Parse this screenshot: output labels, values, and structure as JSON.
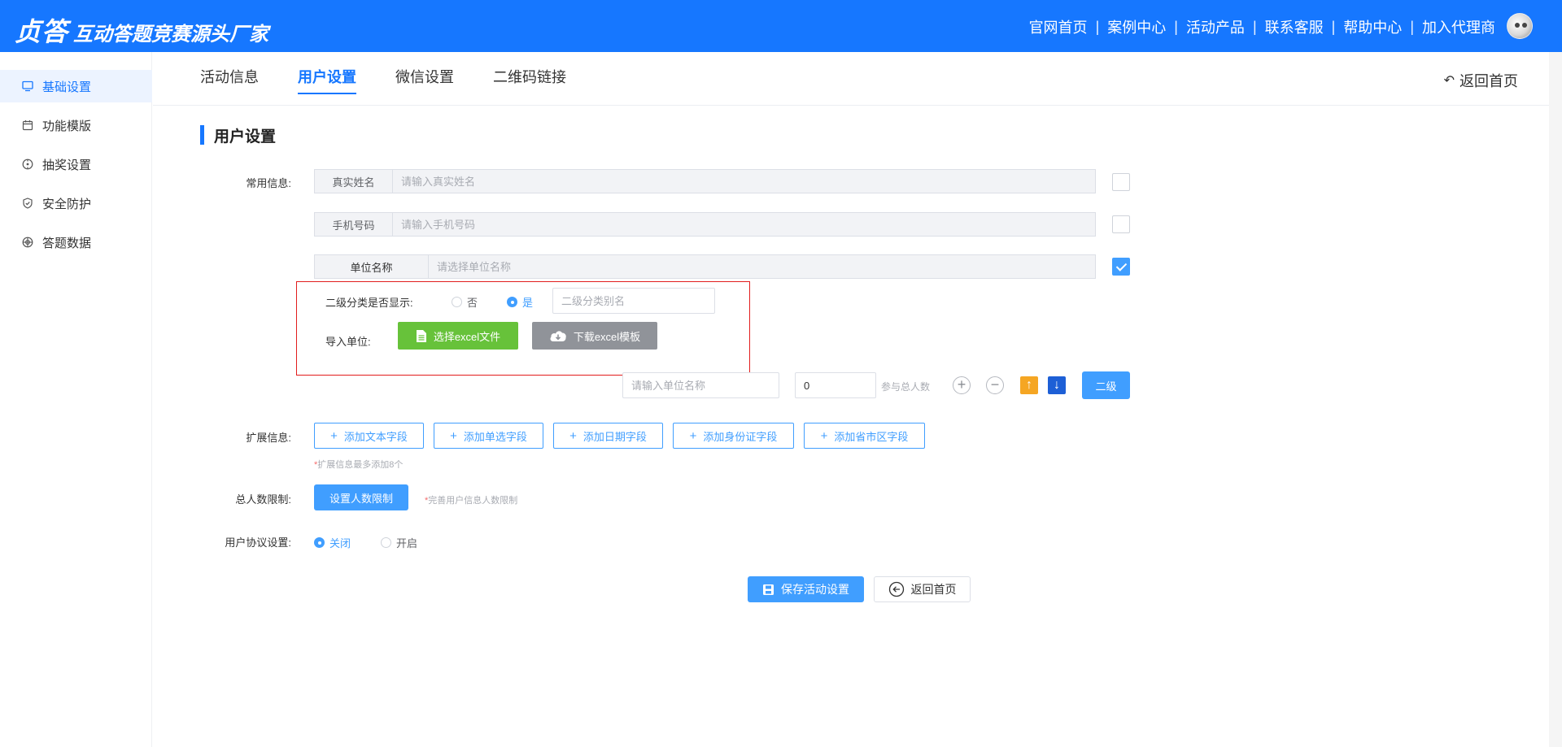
{
  "header": {
    "logo": "贞答",
    "slogan": "互动答题竞赛源头厂家",
    "nav": [
      "官网首页",
      "案例中心",
      "活动产品",
      "联系客服",
      "帮助中心",
      "加入代理商"
    ],
    "separator": "|"
  },
  "sidebar": {
    "items": [
      {
        "label": "基础设置",
        "icon": "monitor-icon",
        "active": true
      },
      {
        "label": "功能模版",
        "icon": "calendar-icon",
        "active": false
      },
      {
        "label": "抽奖设置",
        "icon": "compass-icon",
        "active": false
      },
      {
        "label": "安全防护",
        "icon": "shield-icon",
        "active": false
      },
      {
        "label": "答题数据",
        "icon": "chart-icon",
        "active": false
      }
    ]
  },
  "tabs": {
    "items": [
      "活动信息",
      "用户设置",
      "微信设置",
      "二维码链接"
    ],
    "active": "用户设置",
    "back_home": "返回首页"
  },
  "section": {
    "title": "用户设置"
  },
  "common_info": {
    "label": "常用信息:",
    "fields": [
      {
        "prepend": "真实姓名",
        "placeholder": "请输入真实姓名",
        "checked": false
      },
      {
        "prepend": "手机号码",
        "placeholder": "请输入手机号码",
        "checked": false
      },
      {
        "prepend": "单位名称",
        "placeholder": "请选择单位名称",
        "checked": true
      }
    ]
  },
  "unit_popup": {
    "sub_category_label": "二级分类是否显示:",
    "option_no": "否",
    "option_yes": "是",
    "selected": "是",
    "alias_placeholder": "二级分类别名",
    "import_label": "导入单位:",
    "choose_excel": "选择excel文件",
    "download_template": "下载excel模板"
  },
  "unit_row": {
    "name_placeholder": "请输入单位名称",
    "count_value": "0",
    "count_suffix": "参与总人数",
    "level_button": "二级"
  },
  "extend_info": {
    "label": "扩展信息:",
    "buttons": [
      "添加文本字段",
      "添加单选字段",
      "添加日期字段",
      "添加身份证字段",
      "添加省市区字段"
    ],
    "hint_star": "*",
    "hint": "扩展信息最多添加8个"
  },
  "total_limit": {
    "label": "总人数限制:",
    "button": "设置人数限制",
    "hint_star": "*",
    "hint": "完善用户信息人数限制"
  },
  "agreement": {
    "label": "用户协议设置:",
    "option_off": "关闭",
    "option_on": "开启",
    "selected": "关闭"
  },
  "actions": {
    "save": "保存活动设置",
    "back": "返回首页"
  },
  "colors": {
    "primary": "#1677ff",
    "button_blue": "#409eff",
    "green": "#67c23a",
    "gray": "#909399",
    "orange": "#f5a623",
    "dark_blue": "#1d5fd6",
    "highlight_red": "#e21d1d"
  }
}
